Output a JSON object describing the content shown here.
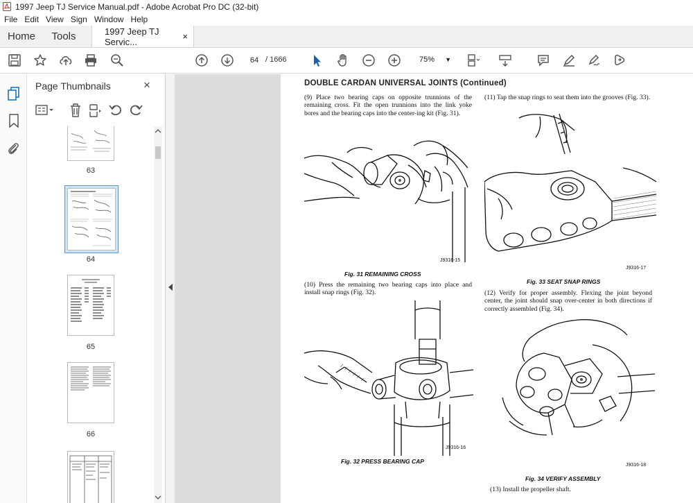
{
  "window": {
    "title": "1997 Jeep TJ Service Manual.pdf - Adobe Acrobat Pro DC (32-bit)"
  },
  "menu": [
    "File",
    "Edit",
    "View",
    "Sign",
    "Window",
    "Help"
  ],
  "tabs": {
    "home": "Home",
    "tools": "Tools",
    "document": "1997 Jeep TJ Servic...",
    "close": "×"
  },
  "toolbar": {
    "page_current": "64",
    "page_total": "/ 1666",
    "zoom": "75%"
  },
  "panel": {
    "title": "Page Thumbnails",
    "close": "×",
    "thumbnails": [
      {
        "label": "63"
      },
      {
        "label": "64",
        "selected": true
      },
      {
        "label": "65"
      },
      {
        "label": "66"
      }
    ]
  },
  "document": {
    "heading": "DOUBLE CARDAN UNIVERSAL JOINTS (Continued)",
    "left": {
      "step9": "(9) Place two bearing caps on opposite trunnions of the remaining cross. Fit the open trunnions into the link yoke bores and the bearing caps into the center-ing kit (Fig. 31).",
      "fig31_id": "J9316-15",
      "fig31_caption": "Fig. 31 REMAINING CROSS",
      "step10": "(10) Press the remaining two bearing caps into place and install snap rings (Fig. 32).",
      "fig32_id": "J9316-16",
      "fig32_caption": "Fig. 32 PRESS BEARING CAP"
    },
    "right": {
      "step11": "(11) Tap the snap rings to seat them into the grooves (Fig. 33).",
      "fig33_id": "J9316-17",
      "fig33_caption": "Fig. 33 SEAT SNAP RINGS",
      "step12": "(12) Verify for proper assembly. Flexing the joint beyond center, the joint should snap over-center in both directions if correctly assembled (Fig. 34).",
      "fig34_id": "J9316-18",
      "fig34_caption": "Fig. 34 VERIFY ASSEMBLY",
      "step13": "(13) Install the propeller shaft."
    }
  }
}
